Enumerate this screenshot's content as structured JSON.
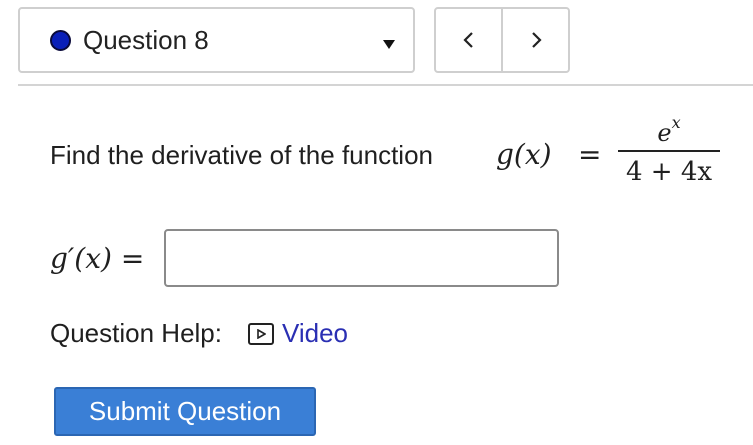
{
  "question_select": {
    "label": "Question 8"
  },
  "nav": {
    "prev_label": "<",
    "next_label": ">"
  },
  "question": {
    "prompt": "Find the derivative of the function",
    "function_lhs": "g(x)",
    "equals": "=",
    "numerator_base": "e",
    "numerator_exponent": "x",
    "denominator": "4 + 4x"
  },
  "answer": {
    "label": "g′(x) =",
    "value": "",
    "placeholder": ""
  },
  "help": {
    "label": "Question Help:",
    "video_label": "Video"
  },
  "submit": {
    "label": "Submit Question"
  },
  "colors": {
    "accent": "#3a7fd6",
    "link": "#2a2fb3",
    "status_dot": "#0a1fb8"
  }
}
